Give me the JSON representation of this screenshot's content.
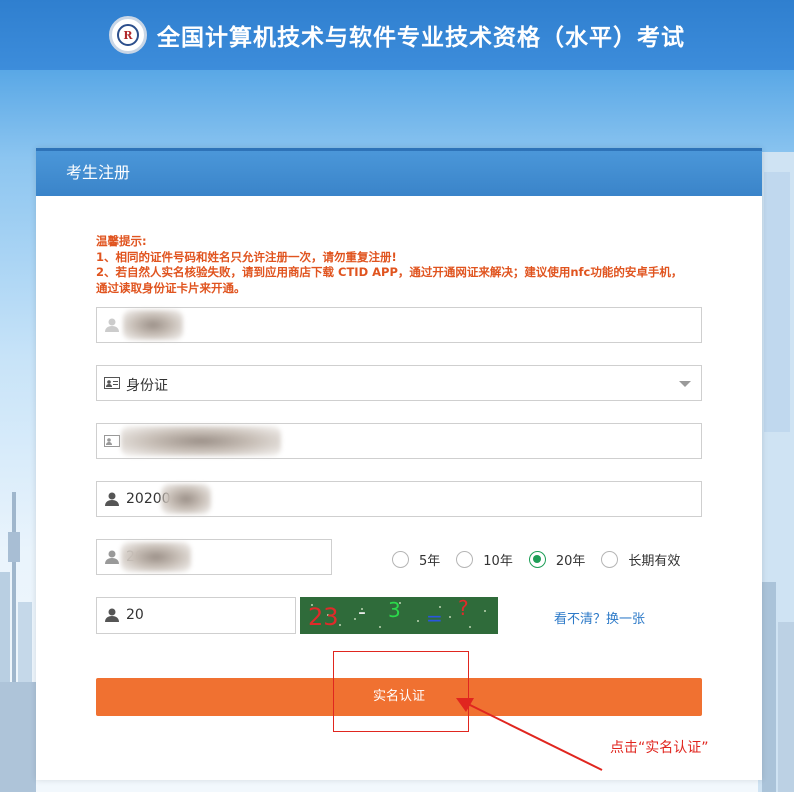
{
  "header": {
    "title": "全国计算机技术与软件专业技术资格（水平）考试"
  },
  "panel": {
    "title": "考生注册"
  },
  "tips": {
    "heading": "温馨提示:",
    "line1": "1、相同的证件号码和姓名只允许注册一次，请勿重复注册!",
    "line2": "2、若自然人实名核验失败，请到应用商店下载 CTID APP，通过开通网证来解决；建议使用nfc功能的安卓手机，",
    "line3": "通过读取身份证卡片来开通。"
  },
  "form": {
    "name_value": "",
    "id_type_value": "身份证",
    "id_number_value": "",
    "start_date_value": "20200",
    "end_date_value": "20400",
    "validity_options": [
      "5年",
      "10年",
      "20年",
      "长期有效"
    ],
    "validity_selected": "20年",
    "captcha_value": "20",
    "captcha_image_text": "23 - 3 = ?",
    "refresh_captcha_label": "看不清？换一张",
    "submit_label": "实名认证"
  },
  "annotation": {
    "text": "点击“实名认证”"
  },
  "colors": {
    "accent": "#f07131",
    "header_blue": "#3a84c9",
    "tip_orange": "#e0541f",
    "annotation_red": "#e0261f",
    "radio_green": "#1e9e57"
  }
}
